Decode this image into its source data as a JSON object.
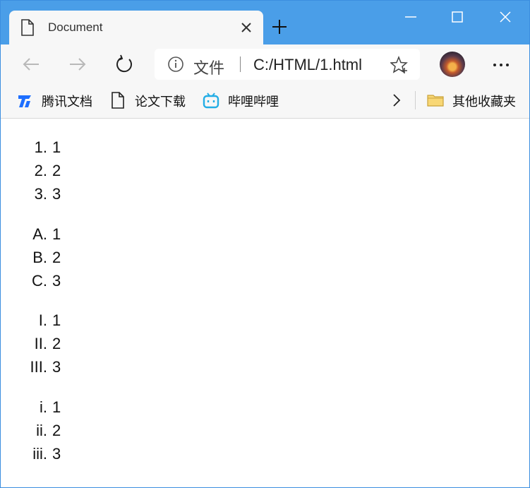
{
  "tab": {
    "title": "Document"
  },
  "address": {
    "file_label": "文件",
    "url": "C:/HTML/1.html"
  },
  "bookmarks": [
    {
      "label": "腾讯文档",
      "icon": "tencent-docs-icon"
    },
    {
      "label": "论文下载",
      "icon": "page-icon"
    },
    {
      "label": "哔哩哔哩",
      "icon": "bilibili-icon"
    }
  ],
  "other_bookmarks": {
    "label": "其他收藏夹",
    "icon": "folder-icon"
  },
  "lists": [
    {
      "type": "decimal",
      "items": [
        {
          "marker": "1.",
          "text": "1"
        },
        {
          "marker": "2.",
          "text": "2"
        },
        {
          "marker": "3.",
          "text": "3"
        }
      ]
    },
    {
      "type": "upper-alpha",
      "items": [
        {
          "marker": "A.",
          "text": "1"
        },
        {
          "marker": "B.",
          "text": "2"
        },
        {
          "marker": "C.",
          "text": "3"
        }
      ]
    },
    {
      "type": "upper-roman",
      "items": [
        {
          "marker": "I.",
          "text": "1"
        },
        {
          "marker": "II.",
          "text": "2"
        },
        {
          "marker": "III.",
          "text": "3"
        }
      ]
    },
    {
      "type": "lower-roman",
      "items": [
        {
          "marker": "i.",
          "text": "1"
        },
        {
          "marker": "ii.",
          "text": "2"
        },
        {
          "marker": "iii.",
          "text": "3"
        }
      ]
    }
  ],
  "colors": {
    "titlebar": "#4a9ee8",
    "tab": "#f7f7f7",
    "toolbar": "#f7f7f7",
    "bilibili": "#23ade5",
    "tencent_docs": "#1e6fff"
  }
}
